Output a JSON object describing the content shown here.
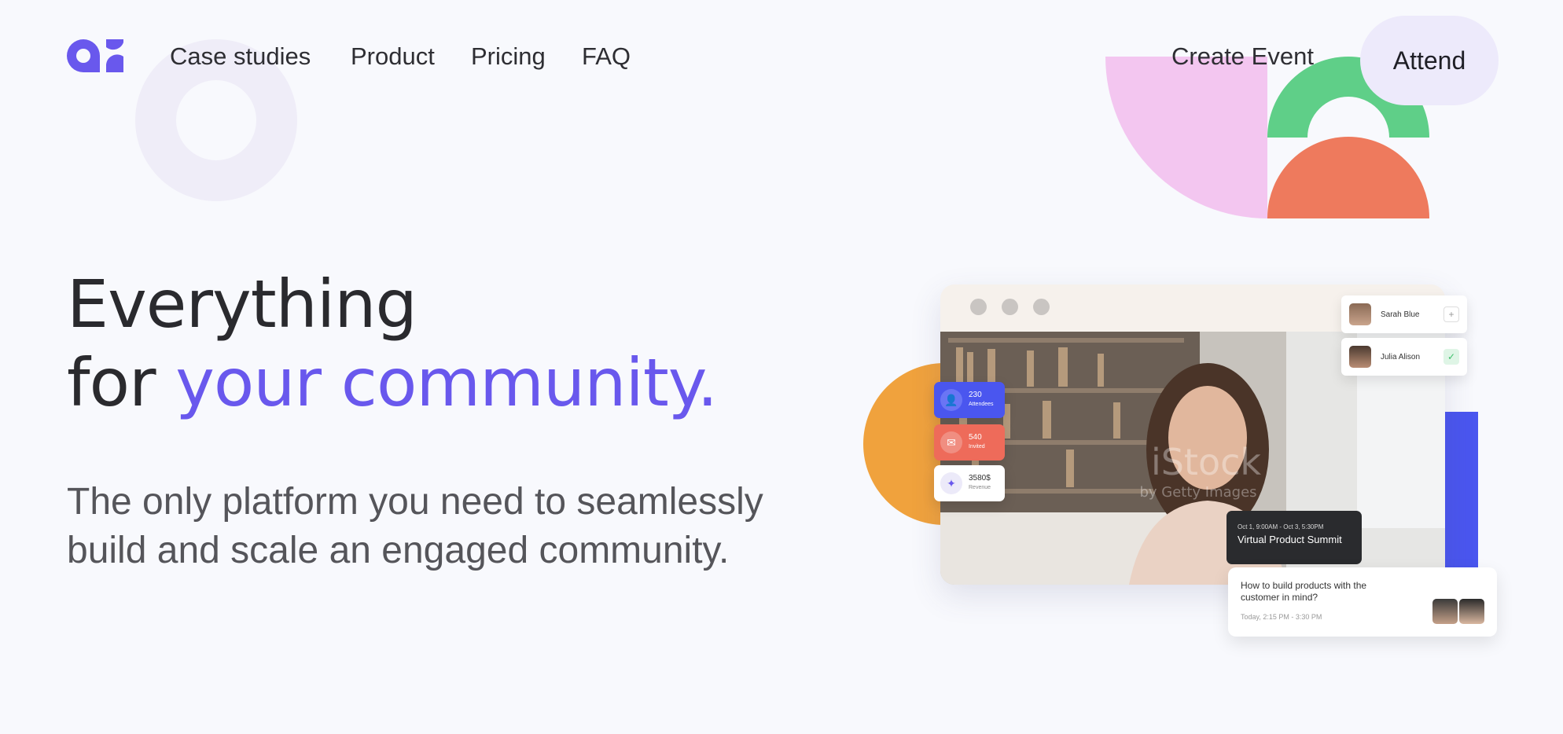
{
  "header": {
    "nav": [
      "Case studies",
      "Product",
      "Pricing",
      "FAQ"
    ],
    "create_event": "Create Event",
    "attend": "Attend"
  },
  "hero": {
    "line1": "Everything",
    "line2_prefix": "for",
    "line2_accent": "your community.",
    "subtitle": "The only platform you need to seamlessly build and scale an engaged community."
  },
  "mockup": {
    "stats": [
      {
        "value": "230",
        "label": "Attendees"
      },
      {
        "value": "540",
        "label": "Invited"
      },
      {
        "value": "3580$",
        "label": "Revenue"
      }
    ],
    "people": [
      {
        "name": "Sarah Blue",
        "action": "+"
      },
      {
        "name": "Julia Alison",
        "action": "✓"
      }
    ],
    "event": {
      "dates": "Oct 1, 9:00AM - Oct 3, 5:30PM",
      "title": "Virtual Product Summit"
    },
    "session": {
      "question": "How to build products with the customer in mind?",
      "time": "Today, 2:15 PM - 3:30 PM"
    }
  },
  "colors": {
    "accent": "#6958ed",
    "pink": "#f3c6f0",
    "green": "#5fcf88",
    "coral": "#ee7a5d",
    "orange": "#f0a23d",
    "blue": "#4a56ef"
  }
}
